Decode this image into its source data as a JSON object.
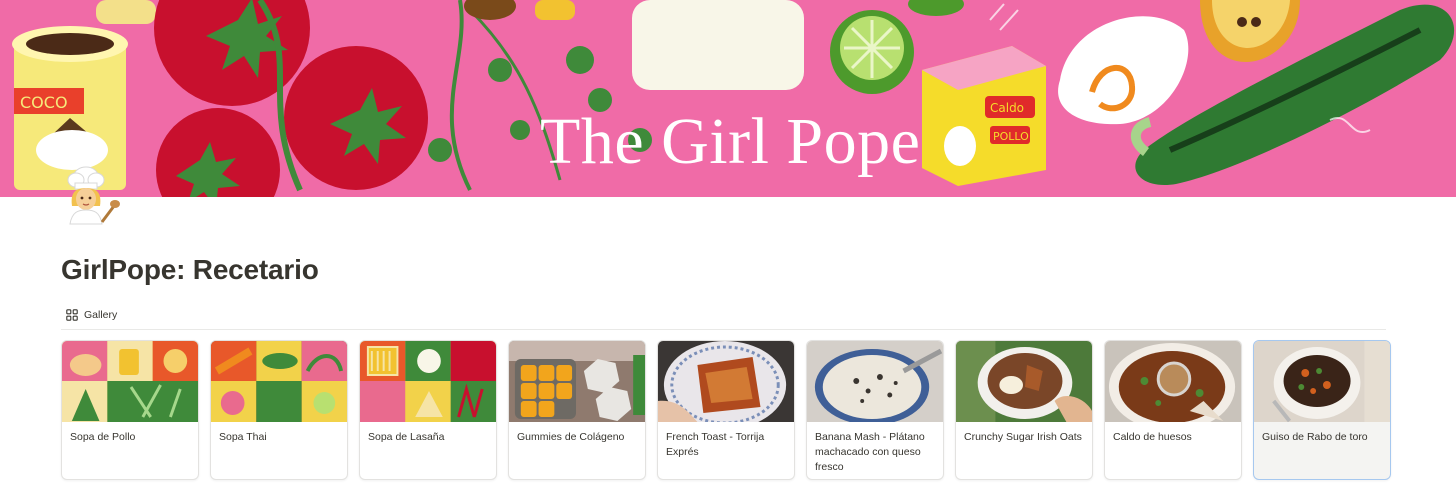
{
  "cover": {
    "title": "The Girl Pope",
    "brand_colors": {
      "pink": "#f06ba7",
      "tomato": "#c8102e",
      "leaf": "#3f8a3a"
    }
  },
  "page": {
    "icon": "chef-emoji-icon",
    "title": "GirlPope: Recetario"
  },
  "view": {
    "tab_label": "Gallery",
    "tab_icon": "grid-icon"
  },
  "cards": [
    {
      "label": "Sopa de Pollo",
      "thumb": "illustration-chicken-vegetables"
    },
    {
      "label": "Sopa Thai",
      "thumb": "illustration-thai-vegetables"
    },
    {
      "label": "Sopa de Lasaña",
      "thumb": "illustration-lasagna-ingredients"
    },
    {
      "label": "Gummies de Colágeno",
      "thumb": "photo-orange-gummies"
    },
    {
      "label": "French Toast - Torrija Exprés",
      "thumb": "photo-french-toast"
    },
    {
      "label": "Banana Mash - Plátano machacado con queso fresco",
      "thumb": "photo-banana-mash"
    },
    {
      "label": "Crunchy Sugar Irish Oats",
      "thumb": "photo-oats-bowl"
    },
    {
      "label": "Caldo de huesos",
      "thumb": "photo-bone-broth"
    },
    {
      "label": "Guiso de Rabo de toro",
      "thumb": "photo-oxtail-stew",
      "selected": true
    }
  ]
}
